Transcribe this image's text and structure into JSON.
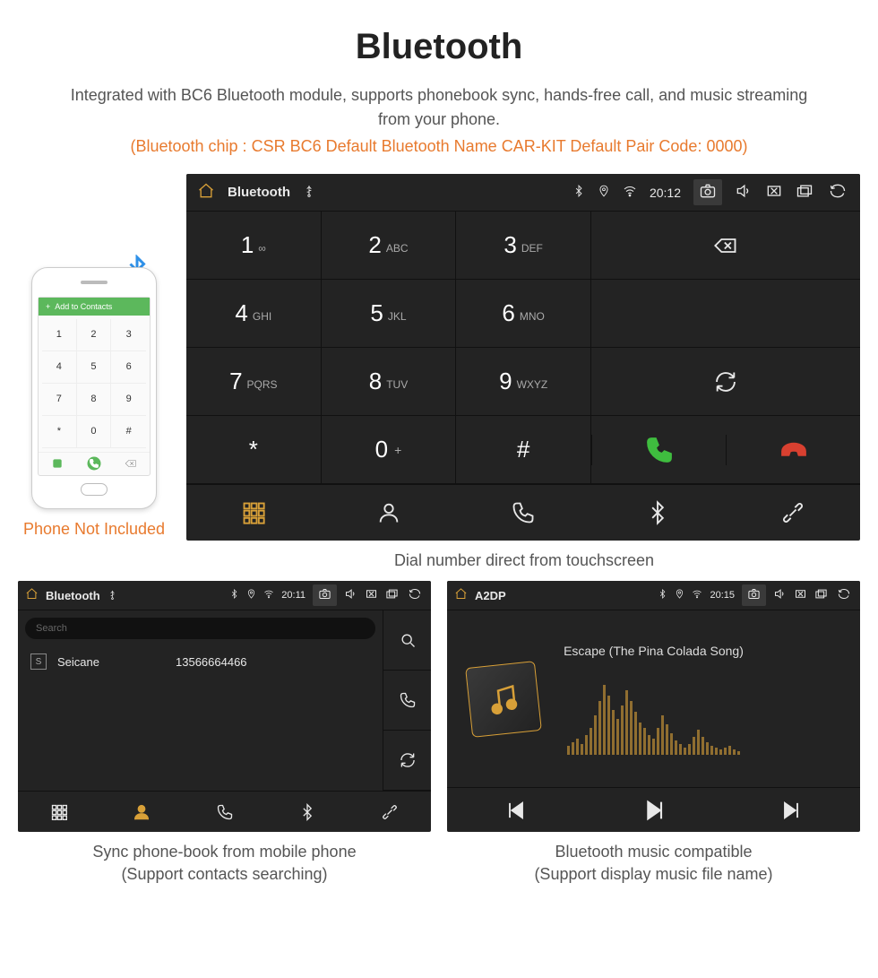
{
  "title": "Bluetooth",
  "description": "Integrated with BC6 Bluetooth module, supports phonebook sync, hands-free call, and music streaming from your phone.",
  "specs": "(Bluetooth chip : CSR BC6     Default Bluetooth Name CAR-KIT     Default Pair Code: 0000)",
  "phone_mock": {
    "header": "Add to Contacts",
    "caption": "Phone Not Included"
  },
  "dialer": {
    "status": {
      "app": "Bluetooth",
      "time": "20:12"
    },
    "keys": [
      {
        "n": "1",
        "l": "∞"
      },
      {
        "n": "2",
        "l": "ABC"
      },
      {
        "n": "3",
        "l": "DEF"
      },
      {
        "n": "4",
        "l": "GHI"
      },
      {
        "n": "5",
        "l": "JKL"
      },
      {
        "n": "6",
        "l": "MNO"
      },
      {
        "n": "7",
        "l": "PQRS"
      },
      {
        "n": "8",
        "l": "TUV"
      },
      {
        "n": "9",
        "l": "WXYZ"
      },
      {
        "n": "*",
        "l": ""
      },
      {
        "n": "0",
        "l": "",
        "sup": "+"
      },
      {
        "n": "#",
        "l": ""
      }
    ],
    "caption": "Dial number direct from touchscreen"
  },
  "phonebook": {
    "status": {
      "app": "Bluetooth",
      "time": "20:11"
    },
    "search_placeholder": "Search",
    "contact": {
      "badge": "S",
      "name": "Seicane",
      "number": "13566664466"
    },
    "caption": "Sync phone-book from mobile phone\n(Support contacts searching)"
  },
  "music": {
    "status": {
      "app": "A2DP",
      "time": "20:15"
    },
    "song": "Escape (The Pina Colada Song)",
    "caption": "Bluetooth music compatible\n(Support display music file name)"
  }
}
